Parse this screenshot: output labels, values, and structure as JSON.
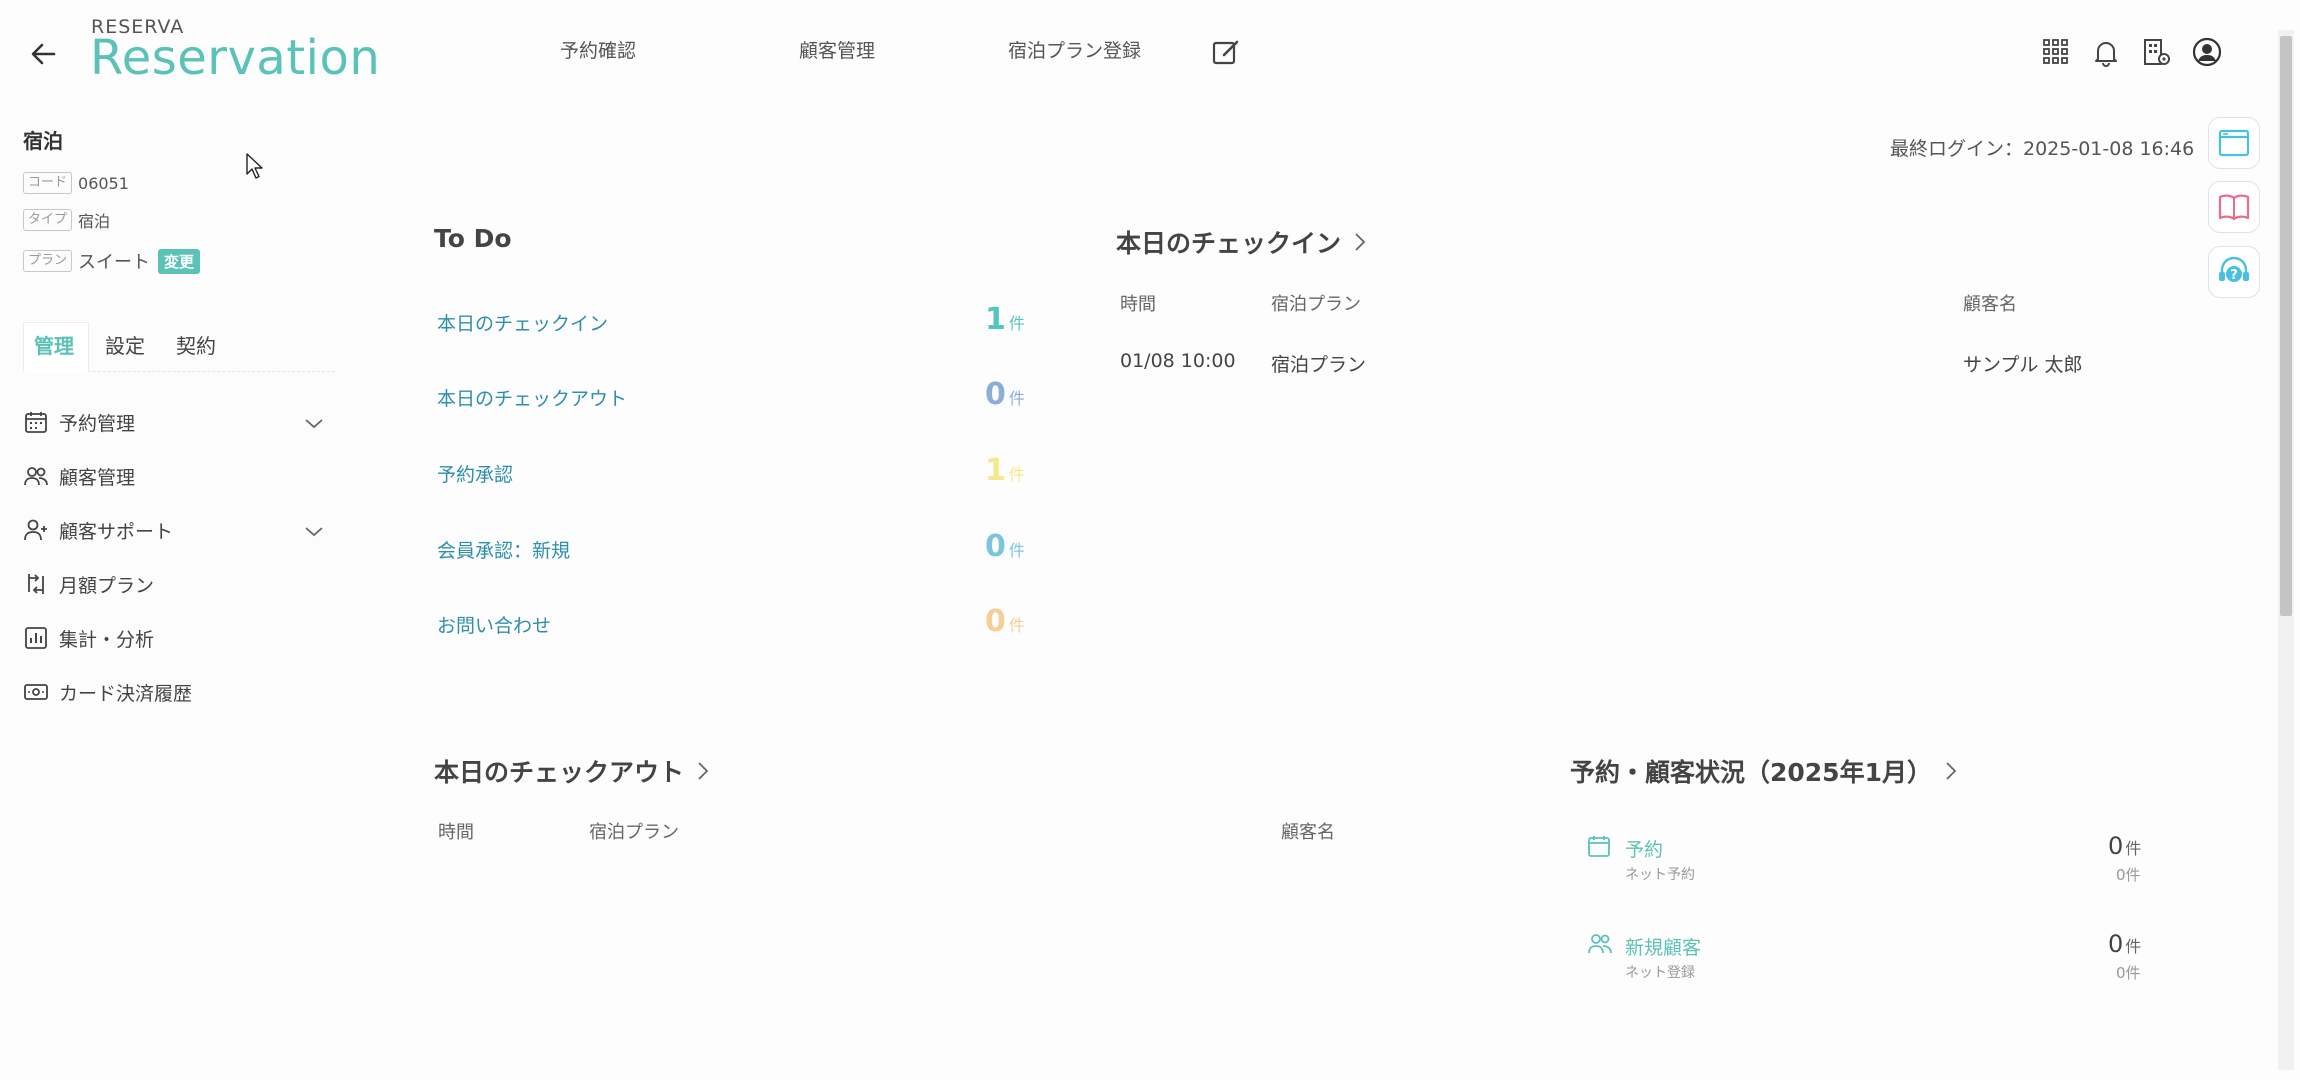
{
  "header": {
    "brand_small": "RESERVA",
    "brand_big": "Reservation",
    "nav": [
      "予約確認",
      "顧客管理",
      "宿泊プラン登録"
    ]
  },
  "sidebar": {
    "store_name": "宿泊",
    "code_tag": "コード",
    "code_value": "06051",
    "type_tag": "タイプ",
    "type_value": "宿泊",
    "plan_tag": "プラン",
    "plan_value": "スイート",
    "plan_change": "変更",
    "tabs": [
      "管理",
      "設定",
      "契約"
    ],
    "menu": [
      {
        "label": "予約管理",
        "icon": "calendar-icon"
      },
      {
        "label": "顧客管理",
        "icon": "users-icon"
      },
      {
        "label": "顧客サポート",
        "icon": "user-plus-icon"
      },
      {
        "label": "月額プラン",
        "icon": "repeat-icon"
      },
      {
        "label": "集計・分析",
        "icon": "chart-icon"
      },
      {
        "label": "カード決済履歴",
        "icon": "card-icon"
      }
    ]
  },
  "main": {
    "last_login": "最終ログイン：2025-01-08 16:46",
    "todo": {
      "title": "To Do",
      "items": [
        {
          "label": "本日のチェックイン",
          "count": "1",
          "unit": "件",
          "color": "#56c5c0"
        },
        {
          "label": "本日のチェックアウト",
          "count": "0",
          "unit": "件",
          "color": "#8aaed6"
        },
        {
          "label": "予約承認",
          "count": "1",
          "unit": "件",
          "color": "#f5e88a"
        },
        {
          "label": "会員承認：新規",
          "count": "0",
          "unit": "件",
          "color": "#7cc5dc"
        },
        {
          "label": "お問い合わせ",
          "count": "0",
          "unit": "件",
          "color": "#f5cf96"
        }
      ]
    },
    "checkin": {
      "title": "本日のチェックイン",
      "headers": [
        "時間",
        "宿泊プラン",
        "顧客名"
      ],
      "rows": [
        [
          "01/08 10:00",
          "宿泊プラン",
          "サンプル 太郎"
        ]
      ]
    },
    "checkout": {
      "title": "本日のチェックアウト",
      "headers": [
        "時間",
        "宿泊プラン",
        "顧客名"
      ]
    },
    "status": {
      "title": "予約・顧客状況（2025年1月）",
      "items": [
        {
          "label": "予約",
          "sub": "ネット予約",
          "num": "0",
          "unit": "件",
          "sub_num": "0",
          "sub_unit": "件"
        },
        {
          "label": "新規顧客",
          "sub": "ネット登録",
          "num": "0",
          "unit": "件",
          "sub_num": "0",
          "sub_unit": "件"
        }
      ]
    }
  },
  "colors": {
    "accent": "#5bc2b8",
    "link": "#2e8fa9"
  }
}
